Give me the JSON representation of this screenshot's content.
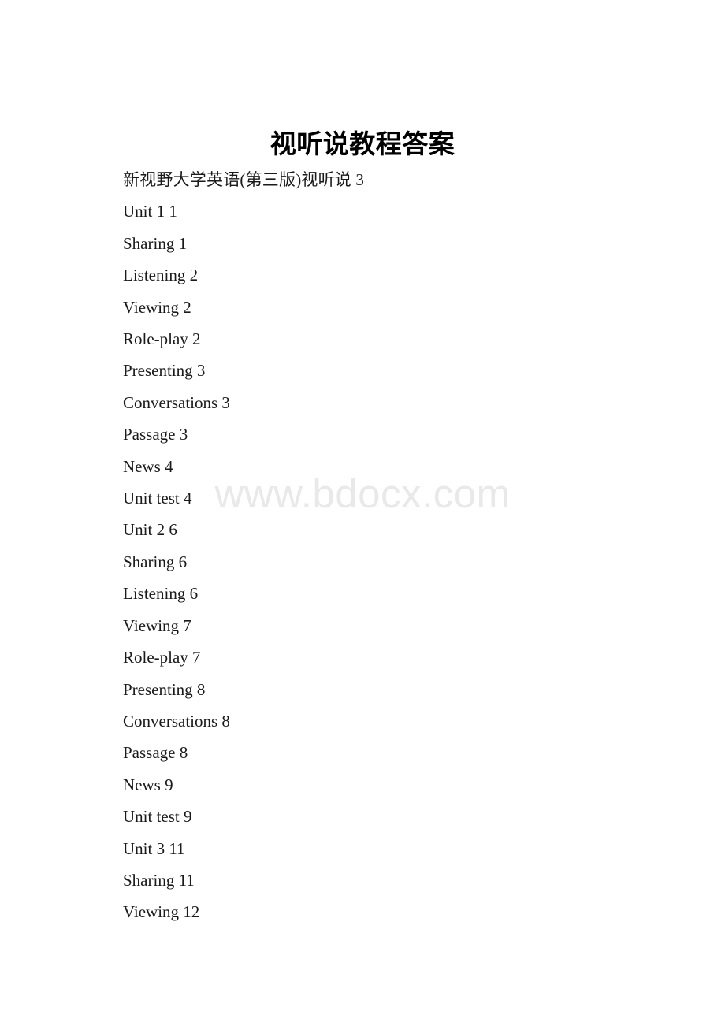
{
  "document": {
    "title": "视听说教程答案",
    "subtitle": "新视野大学英语(第三版)视听说 3",
    "watermark": "www.bdocx.com",
    "toc_entries": [
      "Unit 1 1",
      "Sharing 1",
      "Listening 2",
      "Viewing 2",
      "Role-play 2",
      "Presenting 3",
      "Conversations 3",
      "Passage 3",
      "News 4",
      "Unit test 4",
      "Unit 2 6",
      "Sharing 6",
      "Listening 6",
      "Viewing 7",
      "Role-play 7",
      "Presenting 8",
      "Conversations 8",
      "Passage 8",
      "News 9",
      "Unit test 9",
      "Unit 3 11",
      "Sharing 11",
      "Viewing 12"
    ],
    "colors": {
      "text": "#1a1a1a",
      "title": "#000000",
      "watermark": "#e9e9e9",
      "background": "#ffffff"
    }
  }
}
